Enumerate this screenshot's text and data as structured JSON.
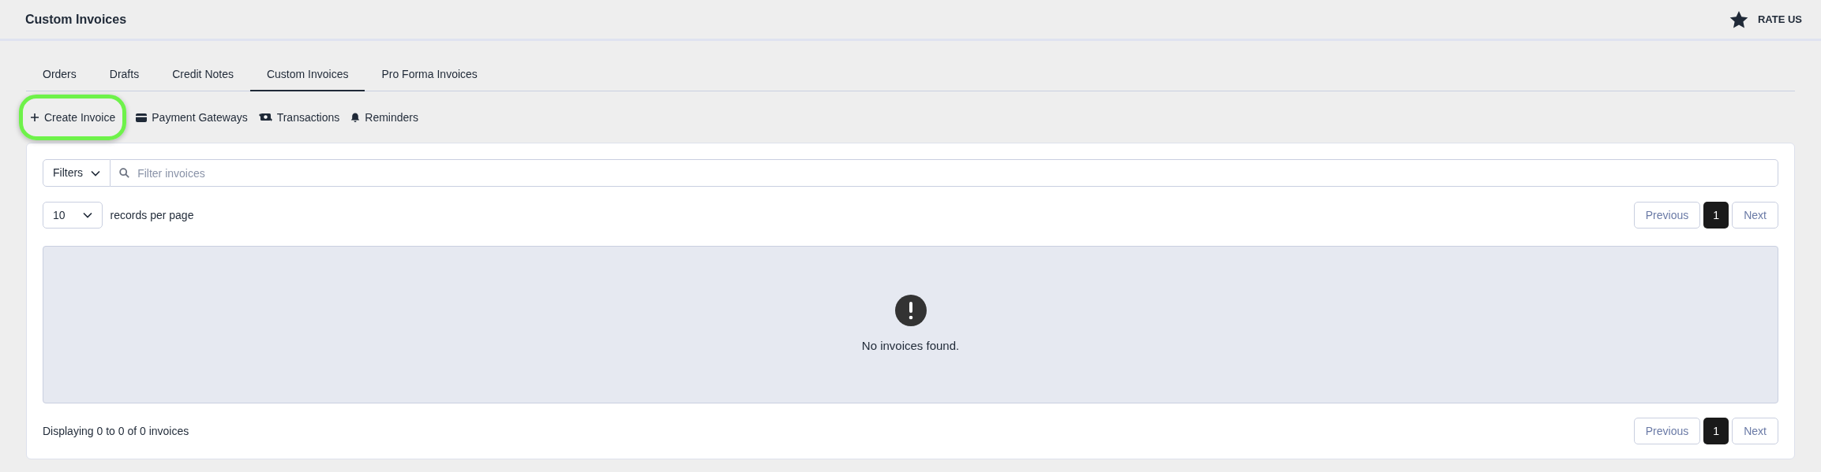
{
  "header": {
    "title": "Custom Invoices",
    "rate_label": "RATE US"
  },
  "tabs": [
    {
      "label": "Orders",
      "selected": false
    },
    {
      "label": "Drafts",
      "selected": false
    },
    {
      "label": "Credit Notes",
      "selected": false
    },
    {
      "label": "Custom Invoices",
      "selected": true
    },
    {
      "label": "Pro Forma Invoices",
      "selected": false
    }
  ],
  "actions": [
    {
      "label": "Create Invoice",
      "kind": "create",
      "highlighted": true
    },
    {
      "label": "Payment Gateways",
      "kind": "gateways",
      "highlighted": false
    },
    {
      "label": "Transactions",
      "kind": "transactions",
      "highlighted": false
    },
    {
      "label": "Reminders",
      "kind": "reminders",
      "highlighted": false
    }
  ],
  "filter": {
    "button": "Filters",
    "placeholder": "Filter invoices"
  },
  "page_size": {
    "value": "10",
    "label": "records per page"
  },
  "pagination_top": {
    "previous": "Previous",
    "pages": [
      {
        "label": "1",
        "selected": true
      }
    ],
    "next": "Next"
  },
  "empty_message": "No invoices found.",
  "footer": {
    "summary": "Displaying 0 to 0 of 0 invoices"
  },
  "pagination_bottom": {
    "previous": "Previous",
    "pages": [
      {
        "label": "1",
        "selected": true
      }
    ],
    "next": "Next"
  }
}
